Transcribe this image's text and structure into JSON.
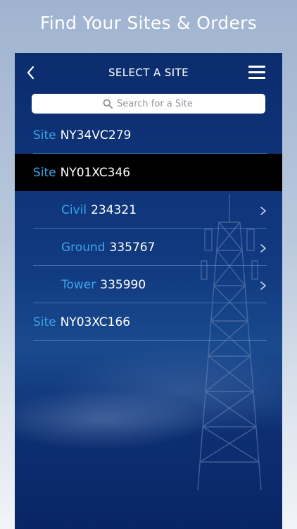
{
  "headline": "Find Your Sites & Orders",
  "header": {
    "title": "SELECT A SITE",
    "back_icon": "chevron-left-icon",
    "menu_icon": "hamburger-menu-icon"
  },
  "search": {
    "placeholder": "Search for a Site",
    "icon": "search-icon"
  },
  "list": [
    {
      "label": "Site",
      "value": "NY34VC279",
      "level": "site",
      "selected": false
    },
    {
      "label": "Site",
      "value": "NY01XC346",
      "level": "site",
      "selected": true
    },
    {
      "label": "Civil",
      "value": "234321",
      "level": "sub",
      "selected": false
    },
    {
      "label": "Ground",
      "value": "335767",
      "level": "sub",
      "selected": false
    },
    {
      "label": "Tower",
      "value": "335990",
      "level": "sub",
      "selected": false
    },
    {
      "label": "Site",
      "value": "NY03XC166",
      "level": "site",
      "selected": false
    }
  ],
  "colors": {
    "label_accent": "#3aa3ea",
    "panel_background": "#0a2a6a",
    "selected_row": "#000000"
  }
}
